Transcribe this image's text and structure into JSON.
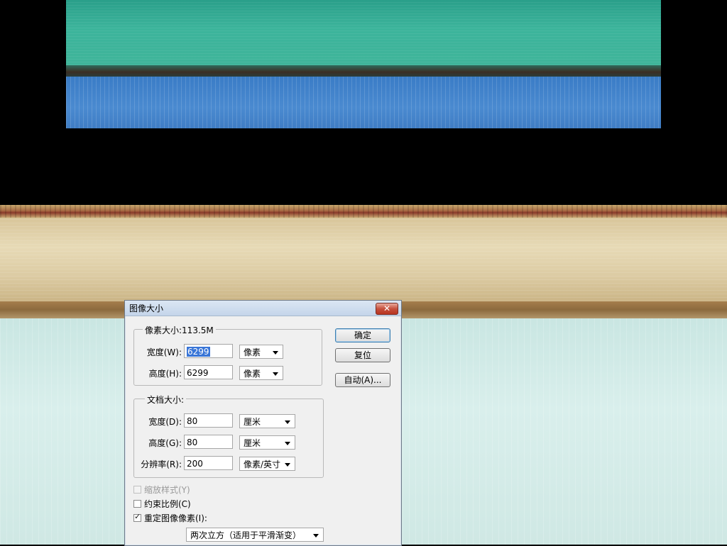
{
  "dialog": {
    "title": "图像大小",
    "close_glyph": "✕",
    "buttons": {
      "ok": "确定",
      "reset": "复位",
      "auto": "自动(A)..."
    },
    "pixel_dimensions": {
      "legend": "像素大小:113.5M",
      "width_label": "宽度(W):",
      "width_value": "6299",
      "width_unit": "像素",
      "height_label": "高度(H):",
      "height_value": "6299",
      "height_unit": "像素"
    },
    "document_size": {
      "legend": "文档大小:",
      "width_label": "宽度(D):",
      "width_value": "80",
      "width_unit": "厘米",
      "height_label": "高度(G):",
      "height_value": "80",
      "height_unit": "厘米",
      "resolution_label": "分辨率(R):",
      "resolution_value": "200",
      "resolution_unit": "像素/英寸"
    },
    "options": {
      "scale_styles": {
        "label": "缩放样式(Y)",
        "checked": false,
        "enabled": false
      },
      "constrain": {
        "label": "约束比例(C)",
        "checked": false,
        "enabled": true
      },
      "resample": {
        "label": "重定图像像素(I):",
        "checked": true,
        "enabled": true
      },
      "resample_method": "两次立方（适用于平滑渐变）"
    }
  },
  "colors": {
    "teal": "#3cb49b",
    "blue": "#4a8ad0",
    "tan": "#e7dab6",
    "aqua": "#d9efec",
    "dialog_bg": "#f0f0f0",
    "selection": "#3875d7"
  }
}
